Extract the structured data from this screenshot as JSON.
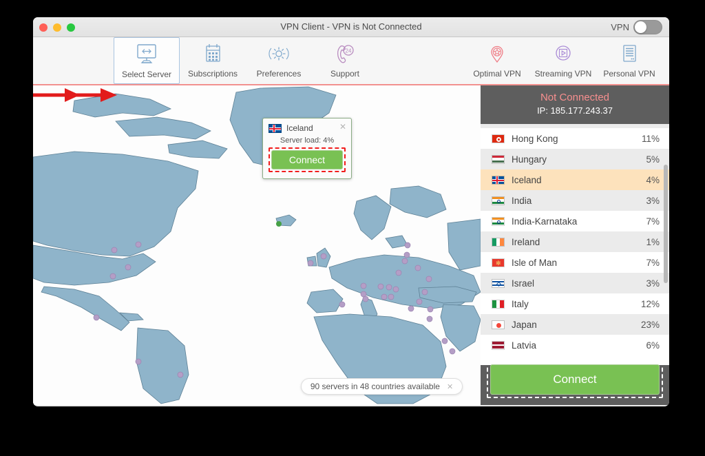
{
  "window": {
    "title": "VPN Client - VPN is Not Connected",
    "traffic_lights": [
      "close",
      "minimize",
      "maximize"
    ],
    "vpn_toggle": {
      "label": "VPN",
      "state": "off"
    }
  },
  "toolbar": {
    "left_items": [
      {
        "label": "Select Server",
        "icon": "monitor-arrows-icon",
        "selected": true
      },
      {
        "label": "Subscriptions",
        "icon": "calendar-icon",
        "selected": false
      },
      {
        "label": "Preferences",
        "icon": "gear-icon",
        "selected": false
      },
      {
        "label": "Support",
        "icon": "phone-24-icon",
        "selected": false
      }
    ],
    "right_items": [
      {
        "label": "Optimal VPN",
        "icon": "pin-star-icon",
        "color": "#ef7d86"
      },
      {
        "label": "Streaming VPN",
        "icon": "play-circle-icon",
        "color": "#a98ad6"
      },
      {
        "label": "Personal VPN",
        "icon": "server-doc-icon",
        "color": "#7fa8cc"
      }
    ],
    "divider_color": "#f2918f"
  },
  "map": {
    "land_color": "#8fb4ca",
    "ocean_color": "#fdfdfd",
    "server_marker_color": "#b49ec6",
    "selected_marker_color": "#46a046",
    "popup": {
      "country": "Iceland",
      "flag": "iceland-flag-icon",
      "server_load_label": "Server load: 4%",
      "connect_label": "Connect",
      "close_icon": "close-icon",
      "highlight": "red-dashed"
    },
    "status_pill": {
      "text": "90 servers in 48 countries available",
      "close_icon": "close-icon"
    },
    "annotations": [
      {
        "type": "red-arrow",
        "points_to": "popup-connect-button"
      },
      {
        "type": "red-arrow",
        "points_to": "panel-connect-button"
      }
    ]
  },
  "panel": {
    "status": "Not Connected",
    "status_color": "#f78f8f",
    "ip": "IP: 185.177.243.37",
    "background": "#5e5e5e",
    "connect_label": "Connect",
    "connect_highlight": "white-dashed",
    "countries": [
      {
        "name": "Hong Kong",
        "load": "11%",
        "flag": "hk",
        "selected": false
      },
      {
        "name": "Hungary",
        "load": "5%",
        "flag": "hu",
        "selected": false
      },
      {
        "name": "Iceland",
        "load": "4%",
        "flag": "is",
        "selected": true
      },
      {
        "name": "India",
        "load": "3%",
        "flag": "in",
        "selected": false
      },
      {
        "name": "India-Karnataka",
        "load": "7%",
        "flag": "in",
        "selected": false
      },
      {
        "name": "Ireland",
        "load": "1%",
        "flag": "ie",
        "selected": false
      },
      {
        "name": "Isle of Man",
        "load": "7%",
        "flag": "im",
        "selected": false
      },
      {
        "name": "Israel",
        "load": "3%",
        "flag": "il",
        "selected": false
      },
      {
        "name": "Italy",
        "load": "12%",
        "flag": "it",
        "selected": false
      },
      {
        "name": "Japan",
        "load": "23%",
        "flag": "jp",
        "selected": false
      },
      {
        "name": "Latvia",
        "load": "6%",
        "flag": "lv",
        "selected": false
      }
    ]
  }
}
